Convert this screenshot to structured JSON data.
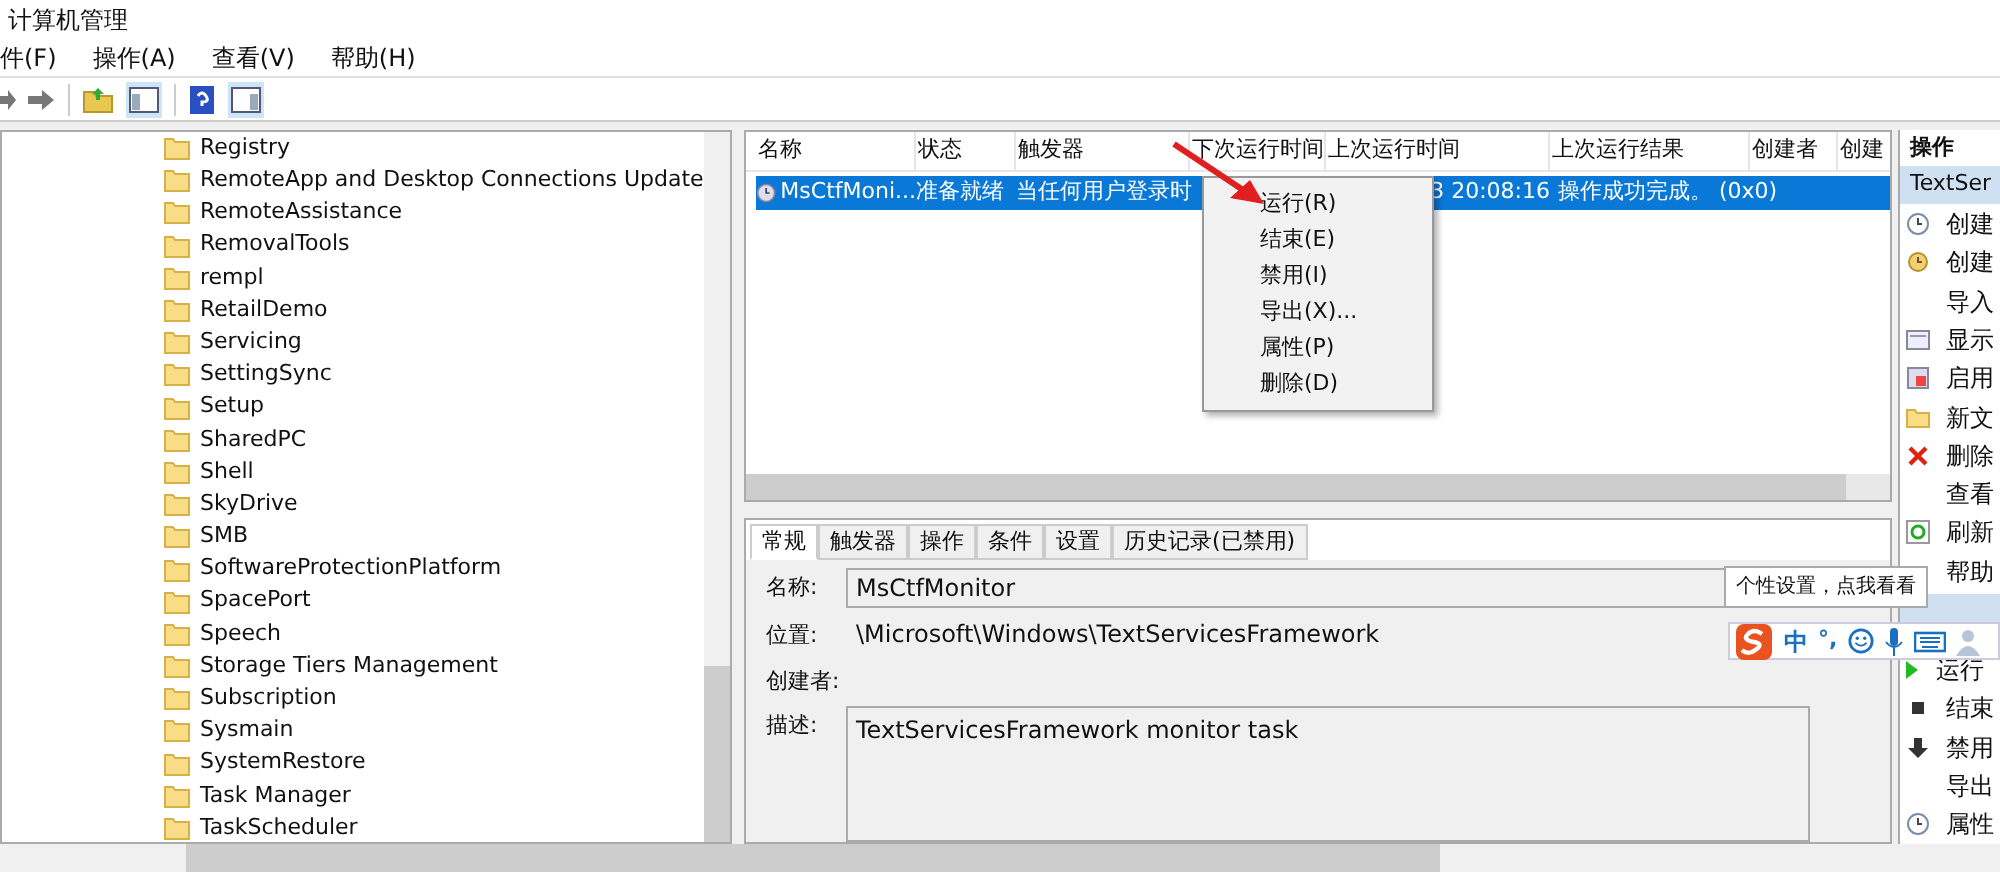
{
  "window": {
    "title": "计算机管理"
  },
  "menu_bar": [
    "件(F)",
    "操作(A)",
    "查看(V)",
    "帮助(H)"
  ],
  "tree": {
    "items": [
      "Registry",
      "RemoteApp and Desktop Connections Update",
      "RemoteAssistance",
      "RemovalTools",
      "rempl",
      "RetailDemo",
      "Servicing",
      "SettingSync",
      "Setup",
      "SharedPC",
      "Shell",
      "SkyDrive",
      "SMB",
      "SoftwareProtectionPlatform",
      "SpacePort",
      "Speech",
      "Storage Tiers Management",
      "Subscription",
      "Sysmain",
      "SystemRestore",
      "Task Manager",
      "TaskScheduler"
    ]
  },
  "task_table": {
    "columns": [
      "名称",
      "状态",
      "触发器",
      "下次运行时间",
      "上次运行时间",
      "上次运行结果",
      "创建者",
      "创建"
    ],
    "rows": [
      {
        "selected": true,
        "name": "MsCtfMoni...",
        "status": "准备就绪",
        "trigger": "当任何用户登录时",
        "last_run": "3 20:08:16",
        "result": "操作成功完成。 (0x0)"
      }
    ]
  },
  "context_menu": {
    "items": [
      "运行(R)",
      "结束(E)",
      "禁用(I)",
      "导出(X)...",
      "属性(P)",
      "删除(D)"
    ]
  },
  "detail_tabs": [
    {
      "label": "常规",
      "selected": true
    },
    {
      "label": "触发器",
      "selected": false
    },
    {
      "label": "操作",
      "selected": false
    },
    {
      "label": "条件",
      "selected": false
    },
    {
      "label": "设置",
      "selected": false
    },
    {
      "label": "历史记录(已禁用)",
      "selected": false
    }
  ],
  "details": [
    {
      "kind": "input",
      "label": "名称:",
      "value": "MsCtfMonitor"
    },
    {
      "kind": "text",
      "label": "位置:",
      "value": "\\Microsoft\\Windows\\TextServicesFramework"
    },
    {
      "kind": "text",
      "label": "创建者:"
    },
    {
      "kind": "textarea",
      "label": "描述:",
      "value": "TextServicesFramework monitor task"
    }
  ],
  "actions_panel": {
    "title": "操作",
    "section": "TextSer",
    "items": [
      {
        "kind": "clock",
        "label": "创建"
      },
      {
        "kind": "task",
        "label": "创建"
      },
      {
        "kind": "none",
        "label": "导入"
      },
      {
        "kind": "display",
        "label": "显示"
      },
      {
        "kind": "enable",
        "label": "启用"
      },
      {
        "kind": "folder",
        "label": "新文"
      },
      {
        "kind": "delete",
        "label": "删除"
      },
      {
        "kind": "none",
        "label": "查看"
      },
      {
        "kind": "refresh",
        "label": "刷新"
      },
      {
        "kind": "none",
        "label": "帮助"
      }
    ],
    "selected_items": [
      {
        "kind": "run",
        "label": "运行"
      },
      {
        "kind": "stop",
        "label": "结束"
      },
      {
        "kind": "disable",
        "label": "禁用"
      },
      {
        "kind": "none",
        "label": "导出"
      },
      {
        "kind": "clock",
        "label": "属性"
      }
    ]
  },
  "ime_bar": {
    "tooltip": "个性设置，点我看看",
    "mode": "中",
    "punctuation": "°,"
  }
}
